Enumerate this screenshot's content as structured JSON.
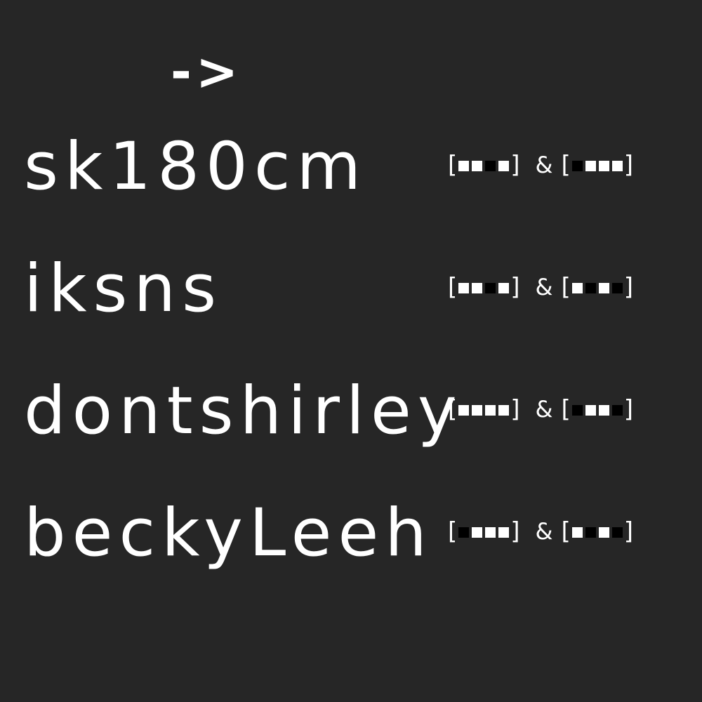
{
  "arrow": "->",
  "amp": "&",
  "colors": {
    "background": "#262626",
    "text": "#ffffff",
    "on": "#ffffff",
    "off": "#000000"
  },
  "rows": [
    {
      "name": "sk180cm",
      "left": [
        1,
        1,
        0,
        1
      ],
      "right": [
        0,
        1,
        1,
        1
      ]
    },
    {
      "name": "iksns",
      "left": [
        1,
        1,
        0,
        1
      ],
      "right": [
        1,
        0,
        1,
        0
      ]
    },
    {
      "name": "dontshirley",
      "left": [
        1,
        1,
        1,
        1
      ],
      "right": [
        0,
        1,
        1,
        0
      ]
    },
    {
      "name": "beckyLeeh",
      "left": [
        0,
        1,
        1,
        1
      ],
      "right": [
        1,
        0,
        1,
        0
      ]
    }
  ]
}
